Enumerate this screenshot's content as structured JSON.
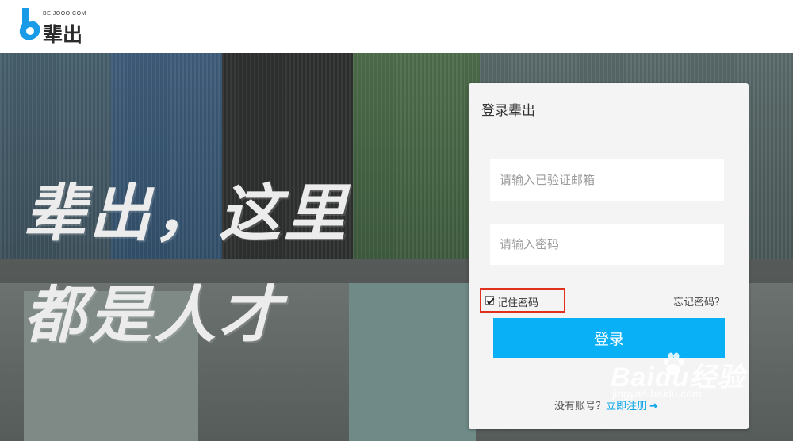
{
  "header": {
    "logo_tagline": "BEIJOOO.COM",
    "logo_name": "辈出"
  },
  "hero": {
    "slogan_line1": "辈出，这里",
    "slogan_line2": "都是人才"
  },
  "login": {
    "title": "登录辈出",
    "email_placeholder": "请输入已验证邮箱",
    "password_placeholder": "请输入密码",
    "remember_label": "记住密码",
    "remember_checked": true,
    "forgot_label": "忘记密码？",
    "submit_label": "登录",
    "no_account_text": "没有账号？",
    "register_label": "立即注册"
  },
  "watermark": {
    "main": "Baidu经验",
    "sub": "jingyan.baidu.com"
  },
  "colors": {
    "accent": "#0ab0f5",
    "highlight_box": "#e0301e",
    "logo_blue": "#1a9be8"
  },
  "icons": [
    "beijooo-logo-icon",
    "checkbox-checked-icon",
    "arrow-right-icon",
    "baidu-paw-icon"
  ]
}
